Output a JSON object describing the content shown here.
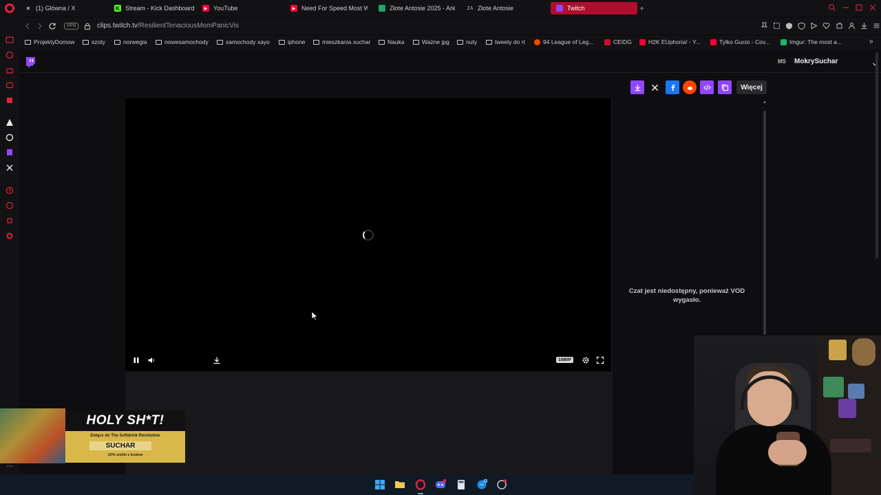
{
  "browser": {
    "tabs": [
      {
        "label": "(1) Główna / X",
        "icon": "x-icon",
        "color": "#ffffff"
      },
      {
        "label": "Stream - Kick Dashboard",
        "icon": "kick-icon",
        "color": "#53fc18"
      },
      {
        "label": "YouTube",
        "icon": "youtube-icon",
        "color": "#ff0033"
      },
      {
        "label": "Need For Speed Most Wa",
        "icon": "youtube-icon",
        "color": "#ff0033"
      },
      {
        "label": "Złote Antosie 2025 - Ark",
        "icon": "sheets-icon",
        "color": "#1fa463"
      },
      {
        "label": "Złote Antosie",
        "icon": "site-icon",
        "color": "#888888"
      },
      {
        "label": "Twitch",
        "icon": "twitch-icon",
        "color": "#9146ff"
      }
    ],
    "new_tab": "+",
    "address": {
      "vpn": "VPN",
      "host": "clips.twitch.tv",
      "path": "/ResilientTenaciousMomPanicVis"
    },
    "bookmarks": [
      {
        "label": "ProjektyDomow",
        "kind": "folder"
      },
      {
        "label": "szoty",
        "kind": "folder"
      },
      {
        "label": "norwegia",
        "kind": "folder"
      },
      {
        "label": "nowesamochody",
        "kind": "folder"
      },
      {
        "label": "samochody xayo",
        "kind": "folder"
      },
      {
        "label": "iphone",
        "kind": "folder"
      },
      {
        "label": "mieszkania suchar",
        "kind": "folder"
      },
      {
        "label": "Nauka",
        "kind": "folder"
      },
      {
        "label": "Ważne jpg",
        "kind": "folder"
      },
      {
        "label": "nuty",
        "kind": "folder"
      },
      {
        "label": "tweety do rt",
        "kind": "folder"
      },
      {
        "label": "94 League of Leg...",
        "kind": "site",
        "color": "#ff4500"
      },
      {
        "label": "CEIDG",
        "kind": "site",
        "color": "#c8102e"
      },
      {
        "label": "H2K EUphoria! - Y...",
        "kind": "site",
        "color": "#ff0033"
      },
      {
        "label": "Tylko Gucio - Cov...",
        "kind": "site",
        "color": "#ff0033"
      },
      {
        "label": "Imgur: The most a...",
        "kind": "site",
        "color": "#1bb76e"
      }
    ],
    "bookmarks_more": "»"
  },
  "twitch": {
    "user": {
      "initials": "MS",
      "name": "MokrySuchar"
    },
    "share": {
      "more_label": "Więcej",
      "accent": "#9146ff"
    },
    "player": {
      "quality": "1080P",
      "state": "loading"
    },
    "chat": {
      "message": "Czat jest niedostępny, ponieważ VOD wygasło."
    }
  },
  "sponsor": {
    "headline": "HOLY SH*T!",
    "subline": "Dołącz do The Softdrink Revolution",
    "code": "SUCHAR",
    "note": "10% zniżki z kodem"
  }
}
